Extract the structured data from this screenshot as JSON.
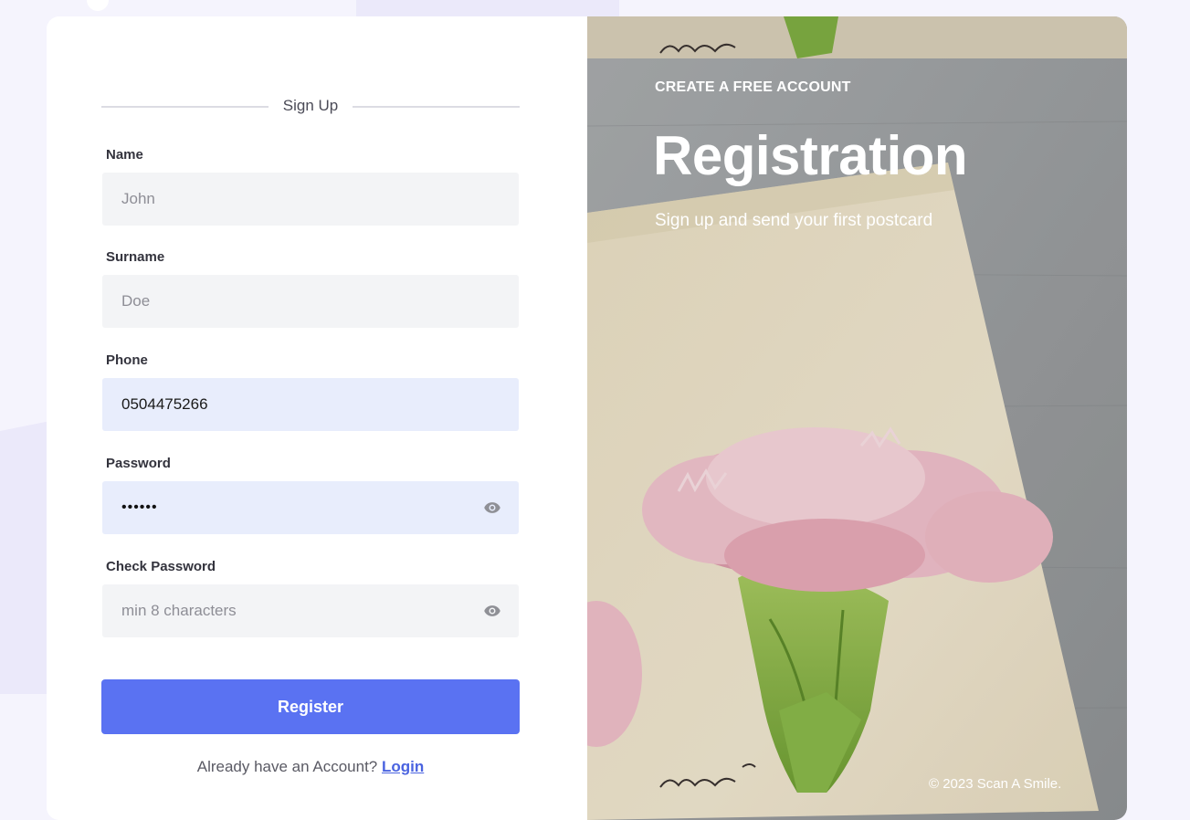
{
  "form": {
    "heading": "Sign Up",
    "fields": [
      {
        "label": "Name",
        "value": "",
        "placeholder": "John",
        "type": "text"
      },
      {
        "label": "Surname",
        "value": "",
        "placeholder": "Doe",
        "type": "text"
      },
      {
        "label": "Phone",
        "value": "0504475266",
        "placeholder": "",
        "type": "tel"
      },
      {
        "label": "Password",
        "value": "••••••",
        "placeholder": "",
        "type": "password",
        "icon": "eye-icon"
      },
      {
        "label": "Check Password",
        "value": "",
        "placeholder": "min 8 characters",
        "type": "password",
        "icon": "eye-icon"
      }
    ],
    "submit_label": "Register",
    "login_prompt": "Already have an Account?",
    "login_link": "Login"
  },
  "hero": {
    "kicker": "CREATE A FREE ACCOUNT",
    "title": "Registration",
    "subtitle": "Sign up and send your first postcard",
    "copyright": "© 2023 Scan A Smile.",
    "image_subject": "pink carnation on handwritten postcard"
  },
  "colors": {
    "primary": "#5a72f2",
    "filled_input": "#e8edfc",
    "empty_input": "#f3f4f6",
    "page_bg": "#f5f4fd"
  }
}
